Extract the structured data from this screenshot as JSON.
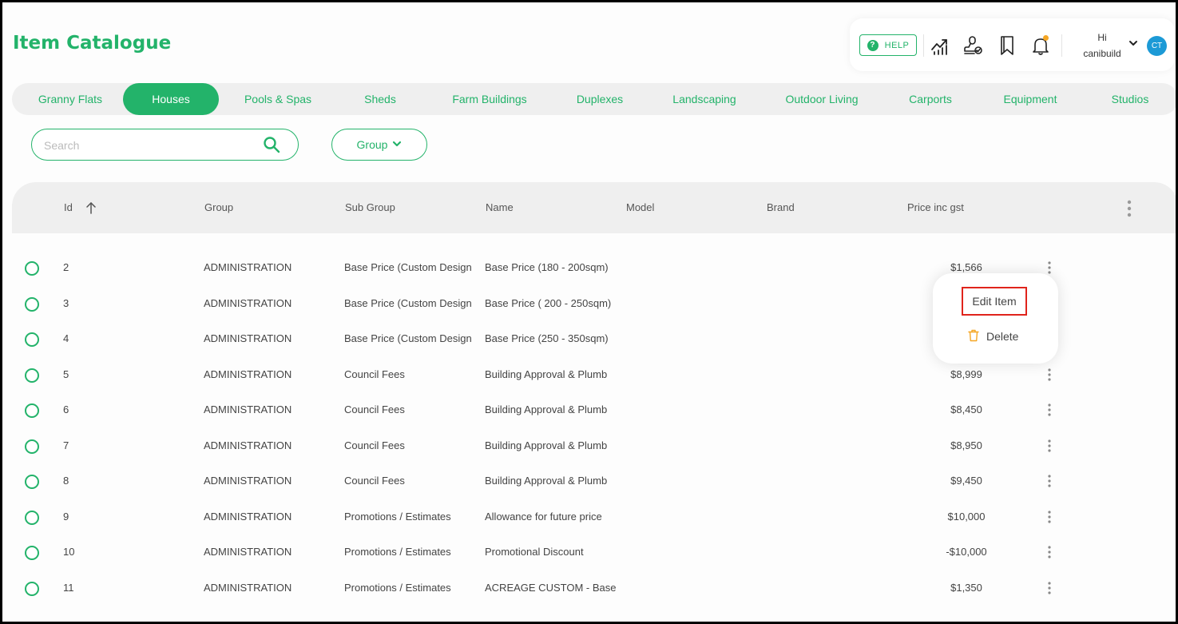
{
  "page": {
    "title": "Item Catalogue"
  },
  "topbar": {
    "help_label": "HELP",
    "icons": [
      "chart-icon",
      "stamp-icon",
      "bookmark-icon",
      "bell-icon"
    ],
    "greeting_line1": "Hi",
    "greeting_line2": "canibuild",
    "avatar_initials": "CT"
  },
  "tabs": [
    {
      "label": "Granny Flats",
      "active": false
    },
    {
      "label": "Houses",
      "active": true
    },
    {
      "label": "Pools & Spas",
      "active": false
    },
    {
      "label": "Sheds",
      "active": false
    },
    {
      "label": "Farm Buildings",
      "active": false
    },
    {
      "label": "Duplexes",
      "active": false
    },
    {
      "label": "Landscaping",
      "active": false
    },
    {
      "label": "Outdoor Living",
      "active": false
    },
    {
      "label": "Carports",
      "active": false
    },
    {
      "label": "Equipment",
      "active": false
    },
    {
      "label": "Studios",
      "active": false
    }
  ],
  "filters": {
    "search_placeholder": "Search",
    "search_value": "",
    "group_label": "Group"
  },
  "table": {
    "columns": [
      "Id",
      "Group",
      "Sub Group",
      "Name",
      "Model",
      "Brand",
      "Price inc gst"
    ],
    "sort": {
      "column": "Id",
      "direction": "ascending"
    },
    "rows": [
      {
        "id": "2",
        "group": "ADMINISTRATION",
        "sub_group": "Base Price (Custom Design",
        "name": "Base Price (180 - 200sqm)",
        "model": "",
        "brand": "",
        "price": "$1,566"
      },
      {
        "id": "3",
        "group": "ADMINISTRATION",
        "sub_group": "Base Price (Custom Design",
        "name": "Base Price ( 200 - 250sqm)",
        "model": "",
        "brand": "",
        "price": ""
      },
      {
        "id": "4",
        "group": "ADMINISTRATION",
        "sub_group": "Base Price (Custom Design",
        "name": "Base Price (250 - 350sqm)",
        "model": "",
        "brand": "",
        "price": ""
      },
      {
        "id": "5",
        "group": "ADMINISTRATION",
        "sub_group": "Council Fees",
        "name": "Building Approval & Plumb",
        "model": "",
        "brand": "",
        "price": "$8,999"
      },
      {
        "id": "6",
        "group": "ADMINISTRATION",
        "sub_group": "Council Fees",
        "name": "Building Approval & Plumb",
        "model": "",
        "brand": "",
        "price": "$8,450"
      },
      {
        "id": "7",
        "group": "ADMINISTRATION",
        "sub_group": "Council Fees",
        "name": "Building Approval & Plumb",
        "model": "",
        "brand": "",
        "price": "$8,950"
      },
      {
        "id": "8",
        "group": "ADMINISTRATION",
        "sub_group": "Council Fees",
        "name": "Building Approval & Plumb",
        "model": "",
        "brand": "",
        "price": "$9,450"
      },
      {
        "id": "9",
        "group": "ADMINISTRATION",
        "sub_group": "Promotions / Estimates",
        "name": "Allowance for future price",
        "model": "",
        "brand": "",
        "price": "$10,000"
      },
      {
        "id": "10",
        "group": "ADMINISTRATION",
        "sub_group": "Promotions / Estimates",
        "name": "Promotional Discount",
        "model": "",
        "brand": "",
        "price": "-$10,000"
      },
      {
        "id": "11",
        "group": "ADMINISTRATION",
        "sub_group": "Promotions / Estimates",
        "name": "ACREAGE CUSTOM - Base I",
        "model": "",
        "brand": "",
        "price": "$1,350"
      }
    ]
  },
  "context_menu": {
    "edit_label": "Edit Item",
    "delete_label": "Delete",
    "highlight_color": "#e0241c"
  },
  "colors": {
    "accent": "#23b36a",
    "avatar": "#1c9ad6",
    "notification": "#f5a623"
  }
}
